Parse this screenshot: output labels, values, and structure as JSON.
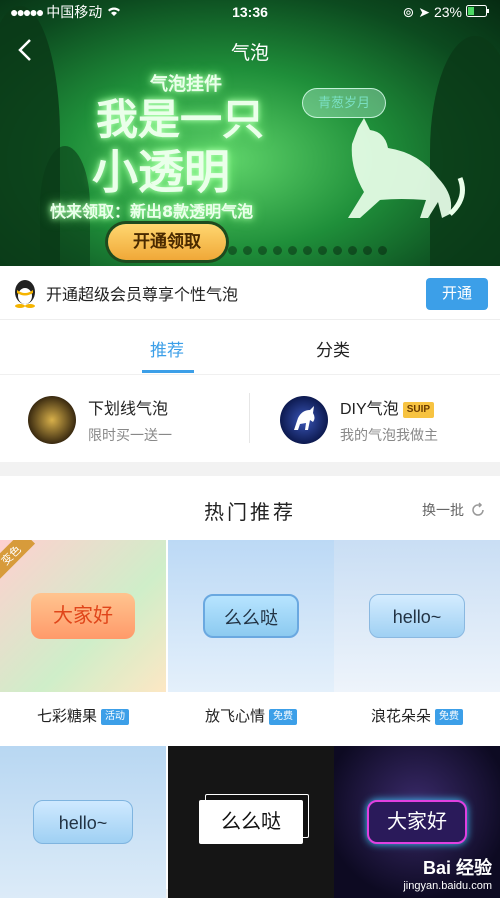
{
  "status_bar": {
    "carrier": "中国移动",
    "time": "13:36",
    "battery": "23%"
  },
  "header": {
    "title": "气泡"
  },
  "banner": {
    "small_text": "气泡挂件",
    "headline_line1": "我是一只",
    "headline_line2": "小透明",
    "subline": "快来领取：新出8款透明气泡",
    "tag": "青葱岁月",
    "button": "开通领取",
    "dots_count": 11
  },
  "vip": {
    "text": "开通超级会员尊享个性气泡",
    "button": "开通"
  },
  "tabs": [
    {
      "label": "推荐"
    },
    {
      "label": "分类"
    }
  ],
  "features": [
    {
      "title": "下划线气泡",
      "subtitle": "限时买一送一"
    },
    {
      "title": "DIY气泡",
      "badge": "SUIP",
      "subtitle": "我的气泡我做主"
    }
  ],
  "hot": {
    "title": "热门推荐",
    "refresh": "换一批",
    "items": [
      {
        "name": "七彩糖果",
        "badge": "活动",
        "bubble_text": "大家好",
        "corner": "变色"
      },
      {
        "name": "放飞心情",
        "badge": "免费",
        "bubble_text": "么么哒"
      },
      {
        "name": "浪花朵朵",
        "badge": "免费",
        "bubble_text": "hello~"
      },
      {
        "bubble_text": "hello~"
      },
      {
        "bubble_text": "么么哒"
      },
      {
        "bubble_text": "大家好"
      }
    ]
  },
  "watermark": {
    "brand": "Bai 经验",
    "url": "jingyan.baidu.com"
  }
}
